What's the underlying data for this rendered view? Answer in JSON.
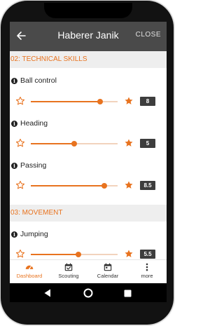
{
  "header": {
    "title": "Haberer Janik",
    "close_label": "CLOSE",
    "back_icon": "arrow-left-icon"
  },
  "sections": [
    {
      "title": "02: TECHNICAL SKILLS",
      "skills": [
        {
          "label": "Ball control",
          "value": "8",
          "fraction": 0.8
        },
        {
          "label": "Heading",
          "value": "5",
          "fraction": 0.5
        },
        {
          "label": "Passing",
          "value": "8.5",
          "fraction": 0.85
        }
      ]
    },
    {
      "title": "03: MOVEMENT",
      "skills": [
        {
          "label": "Jumping",
          "value": "5.5",
          "fraction": 0.55
        }
      ]
    }
  ],
  "bottom_nav": [
    {
      "label": "Dashboard",
      "icon": "speedometer-icon",
      "active": true
    },
    {
      "label": "Scouting",
      "icon": "calendar-check-icon",
      "active": false
    },
    {
      "label": "Calendar",
      "icon": "calendar-icon",
      "active": false
    },
    {
      "label": "more",
      "icon": "more-vertical-icon",
      "active": false
    }
  ],
  "colors": {
    "accent": "#e8731f",
    "app_bar": "#4a4a4a",
    "section_bg": "#eeeeee",
    "badge_bg": "#3d3d3d"
  }
}
